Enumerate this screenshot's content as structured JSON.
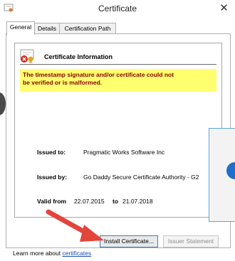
{
  "window": {
    "title": "Certificate",
    "close_glyph": "✕"
  },
  "tabs": [
    {
      "label": "General",
      "active": true
    },
    {
      "label": "Details",
      "active": false
    },
    {
      "label": "Certification Path",
      "active": false
    }
  ],
  "header": {
    "title": "Certificate Information",
    "icon": "certificate-error-icon"
  },
  "warning": {
    "line1": "The timestamp signature and/or certificate could not",
    "line2": "be verified or is malformed."
  },
  "details": {
    "issued_to_label": "Issued to:",
    "issued_to_value": "Pragmatic Works Software Inc",
    "issued_by_label": "Issued by:",
    "issued_by_value": "Go Daddy Secure Certificate Authority - G2",
    "valid_from_label": "Valid from",
    "valid_from_value": "22.07.2015",
    "valid_to_label": "to",
    "valid_to_value": "21.07.2018"
  },
  "buttons": {
    "install": "Install Certificate...",
    "issuer": "Issuer Statement"
  },
  "footer": {
    "prefix": "Learn more about",
    "link": "certificates"
  },
  "colors": {
    "warning_bg": "#ffff70",
    "warning_text": "#8a0000",
    "link": "#1a4fb3",
    "arrow": "#e2453c"
  }
}
